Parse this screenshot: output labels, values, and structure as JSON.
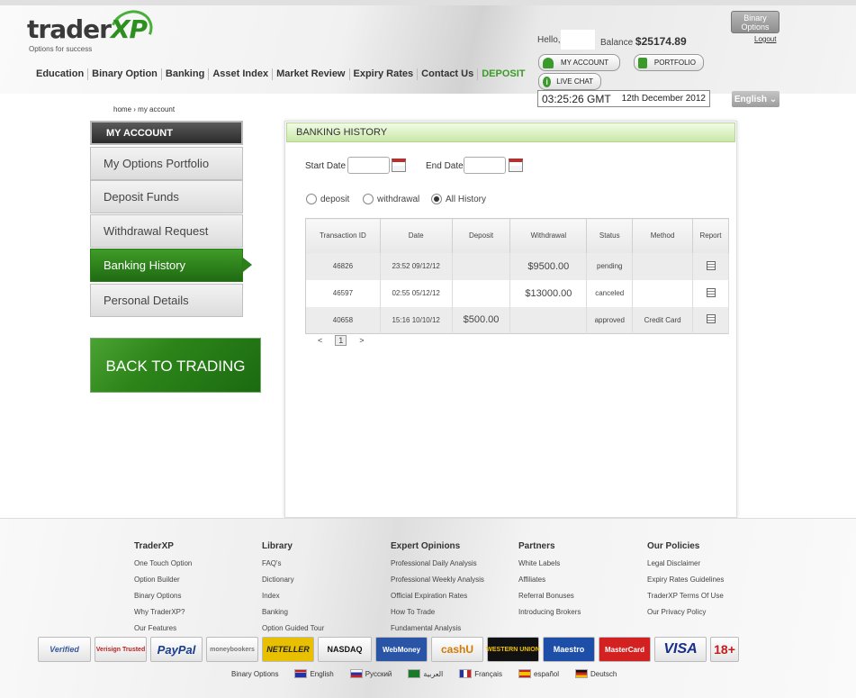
{
  "header": {
    "logo_text_a": "trader",
    "logo_text_b": "XP",
    "logo_tagline": "Options for success",
    "nav": [
      "Education",
      "Binary Option",
      "Banking",
      "Asset Index",
      "Market Review",
      "Expiry Rates",
      "Contact Us",
      "DEPOSIT"
    ],
    "hello_label": "Hello,",
    "balance_label": "Balance",
    "balance_value": "$25174.89",
    "my_account_btn": "MY ACCOUNT",
    "portfolio_btn": "PORTFOLIO",
    "live_chat_btn": "LIVE CHAT",
    "clock_time": "03:25:26 GMT",
    "clock_date": "12th December 2012",
    "binary_options_btn": "Binary Options",
    "logout": "Logout",
    "language": "English"
  },
  "breadcrumb": {
    "home": "home",
    "sep": "›",
    "current": "my account"
  },
  "sidebar": {
    "title": "MY ACCOUNT",
    "items": [
      "My Options Portfolio",
      "Deposit Funds",
      "Withdrawal Request",
      "Banking History",
      "Personal Details"
    ],
    "back_trading": "BACK TO TRADING"
  },
  "panel": {
    "title": "BANKING HISTORY",
    "start_date_label": "Start Date",
    "end_date_label": "End Date",
    "radios": [
      "deposit",
      "withdrawal",
      "All History"
    ],
    "table": {
      "headers": [
        "Transaction ID",
        "Date",
        "Deposit",
        "Withdrawal",
        "Status",
        "Method",
        "Report"
      ],
      "rows": [
        {
          "id": "46826",
          "date": "23:52 09/12/12",
          "deposit": "",
          "withdrawal": "$9500.00",
          "status": "pending",
          "method": ""
        },
        {
          "id": "46597",
          "date": "02:55 05/12/12",
          "deposit": "",
          "withdrawal": "$13000.00",
          "status": "canceled",
          "method": ""
        },
        {
          "id": "40658",
          "date": "15:16 10/10/12",
          "deposit": "$500.00",
          "withdrawal": "",
          "status": "approved",
          "method": "Credit Card"
        }
      ]
    },
    "pager": {
      "prev": "<",
      "page": "1",
      "next": ">"
    }
  },
  "footer": {
    "columns": [
      {
        "title": "TraderXP",
        "links": [
          "One Touch Option",
          "Option Builder",
          "Binary Options",
          "Why TraderXP?",
          "Our Features"
        ]
      },
      {
        "title": "Library",
        "links": [
          "FAQ's",
          "Dictionary",
          "Index",
          "Banking",
          "Option Guided Tour"
        ]
      },
      {
        "title": "Expert Opinions",
        "links": [
          "Professional Daily Analysis",
          "Professional Weekly Analysis",
          "Official Expiration Rates",
          "How To Trade",
          "Fundamental Analysis"
        ]
      },
      {
        "title": "Partners",
        "links": [
          "White Labels",
          "Affiliates",
          "Referral Bonuses",
          "Introducing Brokers"
        ]
      },
      {
        "title": "Our Policies",
        "links": [
          "Legal Disclaimer",
          "Expiry Rates Guidelines",
          "TraderXP Terms Of Use",
          "Our Privacy Policy"
        ]
      }
    ],
    "payments": [
      "Verified",
      "Verisign Trusted",
      "PayPal",
      "moneybookers",
      "NETELLER",
      "NASDAQ",
      "WebMoney",
      "cashU",
      "WESTERN UNION",
      "Maestro",
      "MasterCard",
      "VISA",
      "18+"
    ],
    "languages": [
      "Binary Options",
      "English",
      "Русский",
      "العربية",
      "Français",
      "español",
      "Deutsch"
    ]
  },
  "colors": {
    "brand_green": "#3a9b28",
    "active_green": "#2d7f1c",
    "panel_header": "#c9e8a8"
  }
}
